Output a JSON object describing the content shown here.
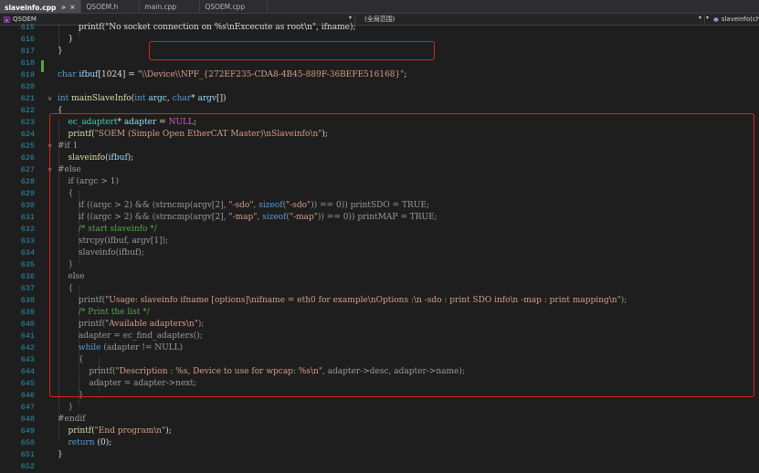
{
  "tabs": [
    {
      "label": "slaveinfo.cpp",
      "pin": "⊳",
      "close": "×",
      "active": true
    },
    {
      "label": "QSOEM.h",
      "active": false
    },
    {
      "label": "main.cpp",
      "active": false
    },
    {
      "label": "QSOEM.cpp",
      "active": false
    }
  ],
  "nav": {
    "project": "QSOEM",
    "scope": "(全局范围)",
    "function": "slaveinfo(char"
  },
  "colors": {
    "highlight": "#e02020",
    "keyword": "#569cd6",
    "string": "#d69d85",
    "comment": "#57a64a",
    "line_number": "#2b91af"
  },
  "lines": [
    {
      "n": "615",
      "fold": "",
      "tokens": [
        {
          "t": "        printf(\"No socket connection on %s\\nExcecute as root\\n\", ifname);",
          "c": "tok-p"
        }
      ]
    },
    {
      "n": "616",
      "fold": "",
      "tokens": [
        {
          "t": "    }",
          "c": "tok-p"
        }
      ]
    },
    {
      "n": "617",
      "fold": "",
      "tokens": [
        {
          "t": "}",
          "c": "tok-p"
        }
      ]
    },
    {
      "n": "618",
      "fold": "",
      "tokens": []
    },
    {
      "n": "619",
      "fold": "",
      "tokens": [
        {
          "t": "char",
          "c": "tok-kw"
        },
        {
          "t": " ",
          "c": "tok-p"
        },
        {
          "t": "ifbuf",
          "c": "tok-id"
        },
        {
          "t": "[1024] = ",
          "c": "tok-p"
        },
        {
          "t": "\"\\\\Device\\\\NPF_{272EF235-CDA8-4B45-889F-36BEFE516168}\"",
          "c": "tok-str"
        },
        {
          "t": ";",
          "c": "tok-p"
        }
      ]
    },
    {
      "n": "620",
      "fold": "",
      "tokens": []
    },
    {
      "n": "621",
      "fold": "∨",
      "tokens": [
        {
          "t": "int",
          "c": "tok-kw"
        },
        {
          "t": " ",
          "c": "tok-p"
        },
        {
          "t": "mainSlaveInfo",
          "c": "tok-fn"
        },
        {
          "t": "(",
          "c": "tok-p"
        },
        {
          "t": "int",
          "c": "tok-kw"
        },
        {
          "t": " ",
          "c": "tok-p"
        },
        {
          "t": "argc",
          "c": "tok-id"
        },
        {
          "t": ", ",
          "c": "tok-p"
        },
        {
          "t": "char",
          "c": "tok-kw"
        },
        {
          "t": "* ",
          "c": "tok-p"
        },
        {
          "t": "argv",
          "c": "tok-id"
        },
        {
          "t": "[])",
          "c": "tok-p"
        }
      ]
    },
    {
      "n": "622",
      "fold": "",
      "tokens": [
        {
          "t": "{",
          "c": "tok-p"
        }
      ]
    },
    {
      "n": "623",
      "fold": "",
      "tokens": [
        {
          "t": "    ",
          "c": "tok-p"
        },
        {
          "t": "ec_adaptert",
          "c": "tok-type"
        },
        {
          "t": "* ",
          "c": "tok-p"
        },
        {
          "t": "adapter",
          "c": "tok-id"
        },
        {
          "t": " = ",
          "c": "tok-p"
        },
        {
          "t": "NULL",
          "c": "tok-mac"
        },
        {
          "t": ";",
          "c": "tok-p"
        }
      ]
    },
    {
      "n": "624",
      "fold": "",
      "tokens": [
        {
          "t": "    ",
          "c": "tok-p"
        },
        {
          "t": "printf",
          "c": "tok-fn"
        },
        {
          "t": "(",
          "c": "tok-p"
        },
        {
          "t": "\"SOEM (Simple Open EtherCAT Master)\\nSlaveinfo\\n\"",
          "c": "tok-str"
        },
        {
          "t": ");",
          "c": "tok-p"
        }
      ]
    },
    {
      "n": "625",
      "fold": "∨",
      "tokens": [
        {
          "t": "#if 1",
          "c": "tok-pp"
        }
      ]
    },
    {
      "n": "626",
      "fold": "",
      "tokens": [
        {
          "t": "    ",
          "c": "tok-p"
        },
        {
          "t": "slaveinfo",
          "c": "tok-fn"
        },
        {
          "t": "(",
          "c": "tok-p"
        },
        {
          "t": "ifbuf",
          "c": "tok-id"
        },
        {
          "t": ");",
          "c": "tok-p"
        }
      ]
    },
    {
      "n": "627",
      "fold": "∨",
      "tokens": [
        {
          "t": "#else",
          "c": "tok-pp"
        }
      ]
    },
    {
      "n": "628",
      "fold": "",
      "tokens": [
        {
          "t": "    if (argc > 1)",
          "c": "tok-inactive"
        }
      ]
    },
    {
      "n": "629",
      "fold": "",
      "tokens": [
        {
          "t": "    {",
          "c": "tok-inactive"
        }
      ]
    },
    {
      "n": "630",
      "fold": "",
      "tokens": [
        {
          "t": "        if ((argc > 2) && (strncmp(argv[2], ",
          "c": "tok-inactive"
        },
        {
          "t": "\"-sdo\"",
          "c": "tok-str"
        },
        {
          "t": ", ",
          "c": "tok-inactive"
        },
        {
          "t": "sizeof",
          "c": "tok-kw"
        },
        {
          "t": "(",
          "c": "tok-inactive"
        },
        {
          "t": "\"-sdo\"",
          "c": "tok-str"
        },
        {
          "t": ")) == 0)) printSDO = TRUE;",
          "c": "tok-inactive"
        }
      ]
    },
    {
      "n": "631",
      "fold": "",
      "tokens": [
        {
          "t": "        if ((argc > 2) && (strncmp(argv[2], ",
          "c": "tok-inactive"
        },
        {
          "t": "\"-map\"",
          "c": "tok-str"
        },
        {
          "t": ", ",
          "c": "tok-inactive"
        },
        {
          "t": "sizeof",
          "c": "tok-kw"
        },
        {
          "t": "(",
          "c": "tok-inactive"
        },
        {
          "t": "\"-map\"",
          "c": "tok-str"
        },
        {
          "t": ")) == 0)) printMAP = TRUE;",
          "c": "tok-inactive"
        }
      ]
    },
    {
      "n": "632",
      "fold": "",
      "tokens": [
        {
          "t": "        /* start slaveinfo */",
          "c": "tok-cm"
        }
      ]
    },
    {
      "n": "633",
      "fold": "",
      "tokens": [
        {
          "t": "        strcpy(ifbuf, argv[1]);",
          "c": "tok-inactive"
        }
      ]
    },
    {
      "n": "634",
      "fold": "",
      "tokens": [
        {
          "t": "        slaveinfo(ifbuf);",
          "c": "tok-inactive"
        }
      ]
    },
    {
      "n": "635",
      "fold": "",
      "tokens": [
        {
          "t": "    }",
          "c": "tok-inactive"
        }
      ]
    },
    {
      "n": "636",
      "fold": "",
      "tokens": [
        {
          "t": "    else",
          "c": "tok-inactive"
        }
      ]
    },
    {
      "n": "637",
      "fold": "",
      "tokens": [
        {
          "t": "    {",
          "c": "tok-inactive"
        }
      ]
    },
    {
      "n": "638",
      "fold": "",
      "tokens": [
        {
          "t": "        printf(",
          "c": "tok-inactive"
        },
        {
          "t": "\"Usage: slaveinfo ifname [options]\\nifname = eth0 for example\\nOptions :\\n -sdo : print SDO info\\n -map : print mapping\\n\"",
          "c": "tok-str"
        },
        {
          "t": ");",
          "c": "tok-inactive"
        }
      ]
    },
    {
      "n": "639",
      "fold": "",
      "tokens": [
        {
          "t": "        /* Print the list */",
          "c": "tok-cm"
        }
      ]
    },
    {
      "n": "640",
      "fold": "",
      "tokens": [
        {
          "t": "        printf(",
          "c": "tok-inactive"
        },
        {
          "t": "\"Available adapters\\n\"",
          "c": "tok-str"
        },
        {
          "t": ");",
          "c": "tok-inactive"
        }
      ]
    },
    {
      "n": "641",
      "fold": "",
      "tokens": [
        {
          "t": "        adapter = ec_find_adapters();",
          "c": "tok-inactive"
        }
      ]
    },
    {
      "n": "642",
      "fold": "",
      "tokens": [
        {
          "t": "        ",
          "c": "tok-inactive"
        },
        {
          "t": "while",
          "c": "tok-kw"
        },
        {
          "t": " (adapter != NULL)",
          "c": "tok-inactive"
        }
      ]
    },
    {
      "n": "643",
      "fold": "",
      "tokens": [
        {
          "t": "        {",
          "c": "tok-inactive"
        }
      ]
    },
    {
      "n": "644",
      "fold": "",
      "tokens": [
        {
          "t": "            printf(",
          "c": "tok-inactive"
        },
        {
          "t": "\"Description : %s, Device to use for wpcap: %s\\n\"",
          "c": "tok-str"
        },
        {
          "t": ", adapter->desc, adapter->name);",
          "c": "tok-inactive"
        }
      ]
    },
    {
      "n": "645",
      "fold": "",
      "tokens": [
        {
          "t": "            adapter = adapter->next;",
          "c": "tok-inactive"
        }
      ]
    },
    {
      "n": "646",
      "fold": "",
      "tokens": [
        {
          "t": "        }",
          "c": "tok-inactive"
        }
      ]
    },
    {
      "n": "647",
      "fold": "",
      "tokens": [
        {
          "t": "    }",
          "c": "tok-inactive"
        }
      ]
    },
    {
      "n": "648",
      "fold": "",
      "tokens": [
        {
          "t": "#endif",
          "c": "tok-pp"
        }
      ]
    },
    {
      "n": "649",
      "fold": "",
      "tokens": [
        {
          "t": "    ",
          "c": "tok-p"
        },
        {
          "t": "printf",
          "c": "tok-fn"
        },
        {
          "t": "(",
          "c": "tok-p"
        },
        {
          "t": "\"End program\\n\"",
          "c": "tok-str"
        },
        {
          "t": ");",
          "c": "tok-p"
        }
      ]
    },
    {
      "n": "650",
      "fold": "",
      "tokens": [
        {
          "t": "    ",
          "c": "tok-p"
        },
        {
          "t": "return",
          "c": "tok-kw"
        },
        {
          "t": " (0);",
          "c": "tok-p"
        }
      ]
    },
    {
      "n": "651",
      "fold": "",
      "tokens": [
        {
          "t": "}",
          "c": "tok-p"
        }
      ]
    },
    {
      "n": "652",
      "fold": "",
      "tokens": []
    }
  ]
}
